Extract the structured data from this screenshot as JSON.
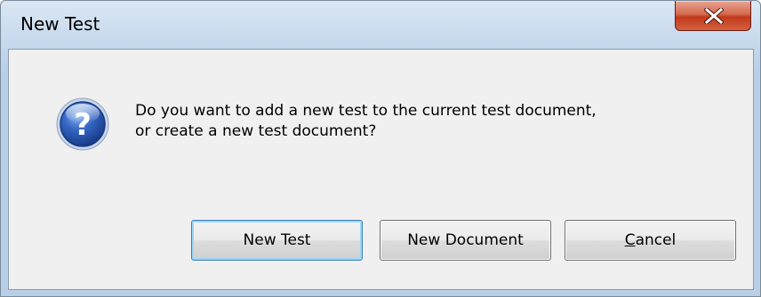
{
  "window": {
    "title": "New Test"
  },
  "dialog": {
    "icon": "question-icon",
    "message_line1": "Do you want to add a new test to the current test document,",
    "message_line2": "or create a new test document?"
  },
  "buttons": {
    "new_test": "New Test",
    "new_document": "New Document",
    "cancel": "Cancel"
  },
  "colors": {
    "frame": "#c9dbee",
    "client": "#f0f0f0",
    "close_button": "#c7432a",
    "default_button_border": "#3c7fb1",
    "icon_blue": "#1f4fa0"
  }
}
